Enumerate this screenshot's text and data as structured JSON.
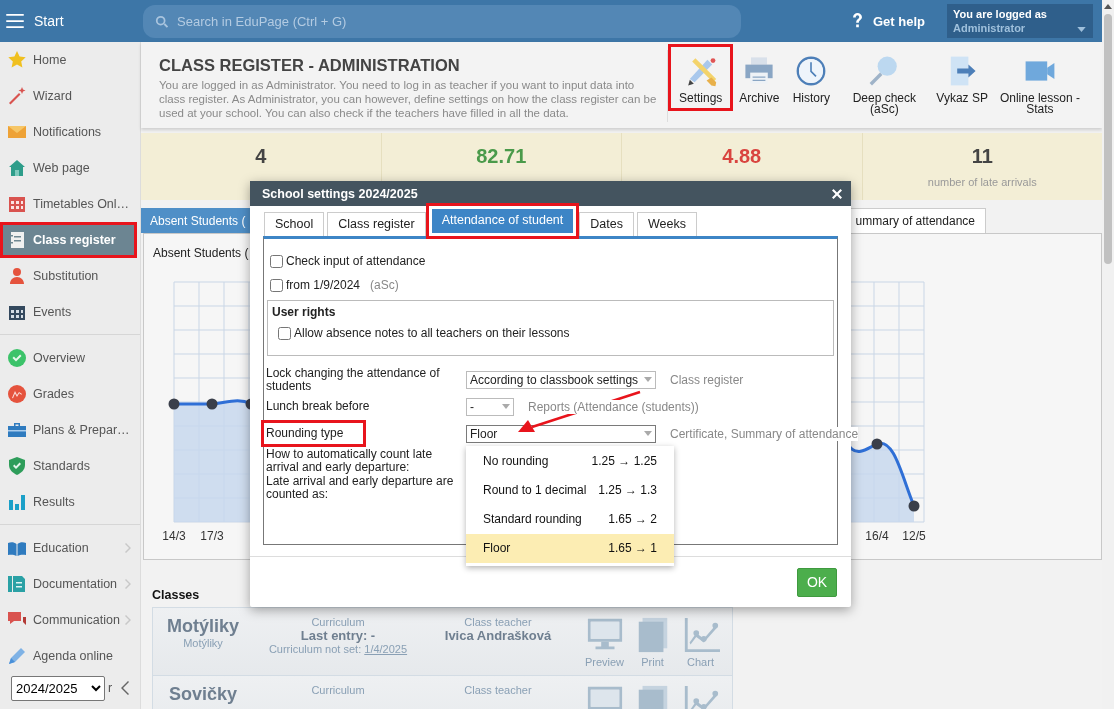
{
  "topbar": {
    "menu_label": "Start",
    "search_placeholder": "Search in EduPage (Ctrl + G)",
    "help_label": "Get help",
    "user_caption": "You are logged as",
    "user_name": "Administrator"
  },
  "sidebar": {
    "groups": [
      [
        {
          "label": "Home",
          "selected": false,
          "highlighted": false,
          "submenu": false
        },
        {
          "label": "Wizard",
          "selected": false,
          "highlighted": false,
          "submenu": false
        },
        {
          "label": "Notifications",
          "selected": false,
          "highlighted": false,
          "submenu": false
        },
        {
          "label": "Web page",
          "selected": false,
          "highlighted": false,
          "submenu": false
        },
        {
          "label": "Timetables Onl…",
          "selected": false,
          "highlighted": false,
          "submenu": false
        },
        {
          "label": "Class register",
          "selected": true,
          "highlighted": true,
          "submenu": false
        },
        {
          "label": "Substitution",
          "selected": false,
          "highlighted": false,
          "submenu": false
        },
        {
          "label": "Events",
          "selected": false,
          "highlighted": false,
          "submenu": false
        }
      ],
      [
        {
          "label": "Overview",
          "selected": false,
          "highlighted": false,
          "submenu": false
        },
        {
          "label": "Grades",
          "selected": false,
          "highlighted": false,
          "submenu": false
        },
        {
          "label": "Plans & Prepar…",
          "selected": false,
          "highlighted": false,
          "submenu": false
        },
        {
          "label": "Standards",
          "selected": false,
          "highlighted": false,
          "submenu": false
        },
        {
          "label": "Results",
          "selected": false,
          "highlighted": false,
          "submenu": false
        }
      ],
      [
        {
          "label": "Education",
          "selected": false,
          "highlighted": false,
          "submenu": true
        },
        {
          "label": "Documentation",
          "selected": false,
          "highlighted": false,
          "submenu": true
        },
        {
          "label": "Communication",
          "selected": false,
          "highlighted": false,
          "submenu": true
        },
        {
          "label": "Agenda online",
          "selected": false,
          "highlighted": false,
          "submenu": false
        }
      ]
    ],
    "hidden_item": "r",
    "year": "2024/2025"
  },
  "header": {
    "title": "CLASS REGISTER - ADMINISTRATION",
    "description": "You are logged in as Administrator. You need to log in as teacher if you want to input data into class register. As Administrator, you can however, define settings on how the class register can be used at your school. You can also check if the teachers have filled in all the data.",
    "toolbar": [
      {
        "label": "Settings",
        "highlighted": true
      },
      {
        "label": "Archive",
        "highlighted": false
      },
      {
        "label": "History",
        "highlighted": false
      },
      {
        "label": "Deep check (aSc)",
        "highlighted": false
      },
      {
        "label": "Vykaz SP",
        "highlighted": false
      },
      {
        "label": "Online lesson - Stats",
        "highlighted": false
      }
    ]
  },
  "stats": [
    {
      "value": "4",
      "color": "#444444"
    },
    {
      "value": "82.71",
      "color": "#4a9a4a"
    },
    {
      "value": "4.88",
      "color": "#d9443f"
    },
    {
      "value": "11",
      "label": "number of late arrivals",
      "color": "#444444"
    }
  ],
  "tabs": [
    {
      "label": "Absent Students (",
      "selected": true
    },
    {
      "label": "ummary of attendance",
      "selected": false
    }
  ],
  "chart": {
    "title": "Absent Students (",
    "x_labels": [
      "14/3",
      "17/3",
      "16/4",
      "12/5"
    ]
  },
  "classes": {
    "title": "Classes",
    "items": [
      {
        "name": "Motýliky",
        "subname": "Motýliky",
        "curriculum_label": "Curriculum",
        "last_entry": "Last entry: -",
        "not_set_label": "Curriculum not set:",
        "not_set_date": "1/4/2025",
        "teacher_label": "Class teacher",
        "teacher": "Ivica Andrašková",
        "actions": [
          "Preview",
          "Print",
          "Chart"
        ]
      },
      {
        "name": "Sovičky",
        "curriculum_label": "Curriculum",
        "teacher_label": "Class teacher"
      }
    ]
  },
  "dialog": {
    "title": "School settings 2024/2025",
    "tabs": [
      {
        "label": "School",
        "selected": false,
        "highlighted": false
      },
      {
        "label": "Class register",
        "selected": false,
        "highlighted": false
      },
      {
        "label": "Attendance of student",
        "selected": true,
        "highlighted": true
      },
      {
        "label": "Dates",
        "selected": false,
        "highlighted": false
      },
      {
        "label": "Weeks",
        "selected": false,
        "highlighted": false
      }
    ],
    "checks": [
      {
        "label": "Check input of attendance",
        "checked": false
      },
      {
        "label": "from 1/9/2024",
        "note": "(aSc)",
        "checked": false
      }
    ],
    "user_rights": {
      "title": "User rights",
      "checks": [
        {
          "label": "Allow absence notes to all teachers on their lessons",
          "checked": false
        }
      ]
    },
    "rows": [
      {
        "label": "Lock changing the attendance of students",
        "value": "According to classbook settings",
        "note": "Class register",
        "highlighted": false
      },
      {
        "label": "Lunch break before",
        "value": "-",
        "note": "Reports (Attendance (students))",
        "highlighted": false
      },
      {
        "label": "Rounding type",
        "value": "Floor",
        "note": "Certificate, Summary of attendance",
        "highlighted": true,
        "pointed": true,
        "open": true,
        "options": [
          {
            "label": "No rounding",
            "example": "1.25 → 1.25",
            "selected": false
          },
          {
            "label": "Round to 1 decimal",
            "example": "1.25 → 1.3",
            "selected": false
          },
          {
            "label": "Standard rounding",
            "example": "1.65 → 2",
            "selected": false
          },
          {
            "label": "Floor",
            "example": "1.65 → 1",
            "selected": true
          }
        ]
      },
      {
        "label": "How to automatically count late arrival and early departure:",
        "highlighted": false
      },
      {
        "label": "Late arrival and early departure are counted as:",
        "highlighted": false
      }
    ],
    "ok": "OK"
  }
}
